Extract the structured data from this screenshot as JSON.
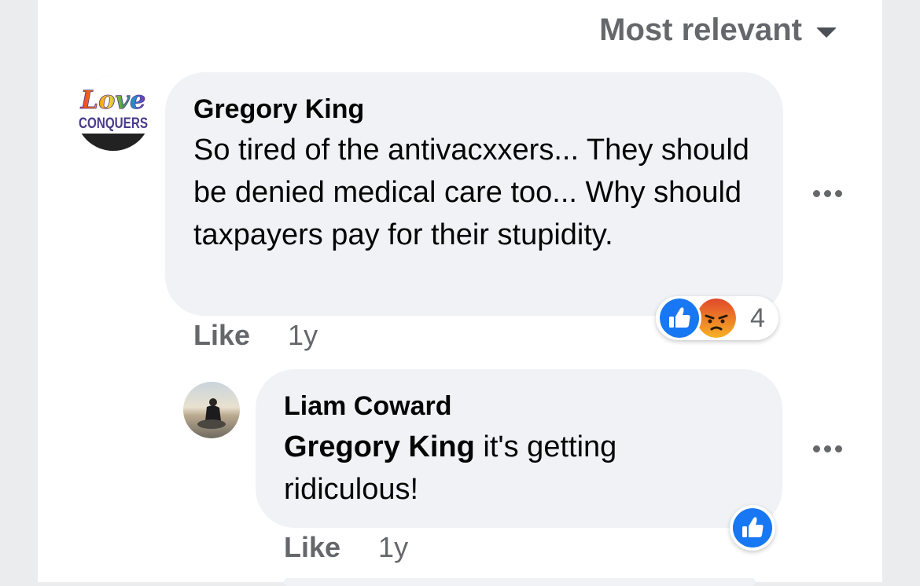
{
  "sort": {
    "label": "Most relevant"
  },
  "comments": [
    {
      "author": "Gregory King",
      "avatar_text": {
        "line1": "Love",
        "line2": "CONQUERS"
      },
      "body": "So tired of the antivacxxers... They should be denied medical care too... Why should taxpayers pay for their stupidity.",
      "like_label": "Like",
      "time": "1y",
      "reactions": {
        "types": [
          "like-icon",
          "angry-icon"
        ],
        "count": "4"
      }
    }
  ],
  "replies": [
    {
      "author": "Liam Coward",
      "mention": "Gregory King",
      "body": " it's getting ridiculous!",
      "like_label": "Like",
      "time": "1y",
      "reactions": {
        "types": [
          "like-icon"
        ]
      }
    }
  ],
  "colors": {
    "like_blue": "#1877f2",
    "angry_orange": "#f0642a",
    "bubble_bg": "#f0f2f5",
    "secondary_text": "#65676b"
  }
}
